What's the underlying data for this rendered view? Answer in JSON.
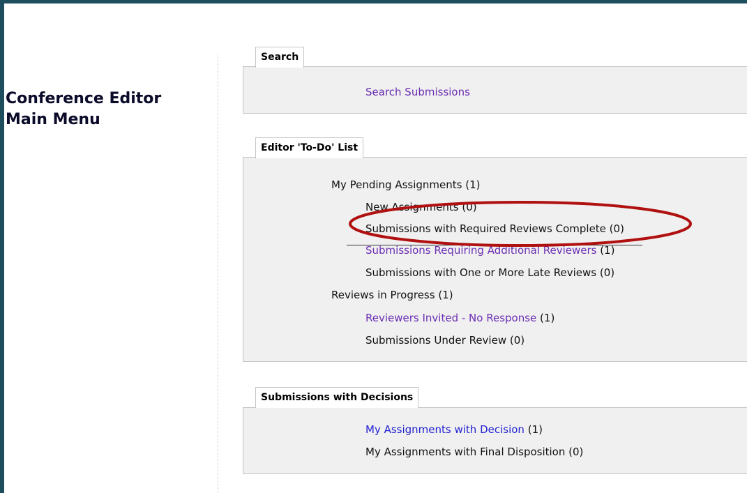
{
  "page_title_line1": "Conference Editor",
  "page_title_line2": "Main Menu",
  "search": {
    "tab": "Search",
    "link": "Search Submissions"
  },
  "todo": {
    "tab": "Editor 'To-Do' List",
    "pending": "My Pending Assignments (1)",
    "new_assignments": "New Assignments (0)",
    "required_complete": "Submissions with Required Reviews Complete (0)",
    "additional_reviewers_link": "Submissions Requiring Additional Reviewers",
    "additional_reviewers_count": "(1)",
    "late_reviews": "Submissions with One or More Late Reviews (0)",
    "in_progress": "Reviews in Progress (1)",
    "invited_link": "Reviewers Invited - No Response",
    "invited_count": "(1)",
    "under_review": "Submissions Under Review (0)"
  },
  "decisions": {
    "tab": "Submissions with Decisions",
    "with_decision_link": "My Assignments with Decision",
    "with_decision_count": "(1)",
    "final_disposition": "My Assignments with Final Disposition (0)"
  },
  "colors": {
    "frame": "#1d4e5e",
    "panel": "#f0f0f0",
    "visited_link": "#6b2fb3",
    "link": "#2323d2",
    "highlight_oval": "#b01010"
  }
}
